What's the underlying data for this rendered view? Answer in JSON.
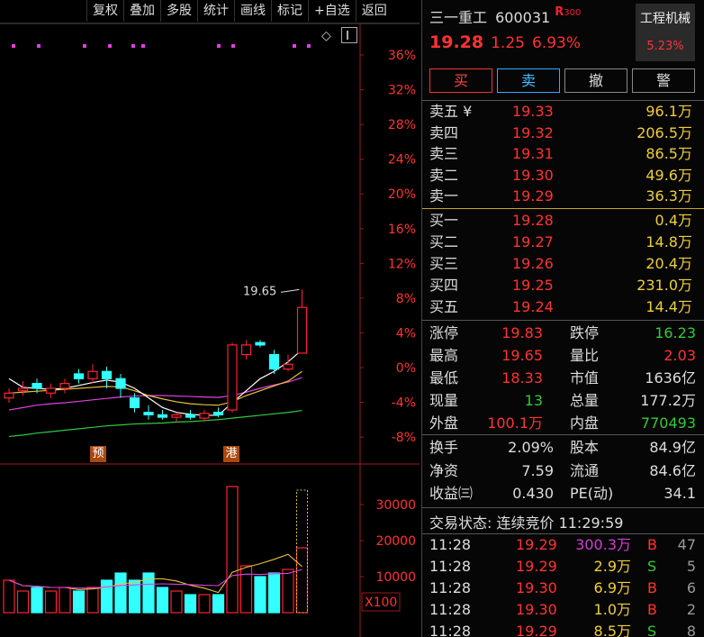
{
  "toolbar": {
    "buttons": [
      "复权",
      "叠加",
      "多股",
      "统计",
      "画线",
      "标记",
      "+自选",
      "返回"
    ]
  },
  "chart": {
    "peak_label": "19.65",
    "y_ticks": [
      "36%",
      "32%",
      "28%",
      "24%",
      "20%",
      "16%",
      "12%",
      "8%",
      "4%",
      "0%",
      "-4%",
      "-8%"
    ],
    "vol_ticks": [
      "30000",
      "20000",
      "10000"
    ],
    "vol_unit": "X100",
    "marker_yu": "预",
    "marker_gang": "港",
    "colors": {
      "up": "#f23",
      "down": "#3ff",
      "ma5": "#ffffff",
      "ma10": "#e8c23a",
      "ma20": "#e040e0",
      "ma60": "#2ecc40"
    }
  },
  "chart_data": {
    "type": "candlestick",
    "candles": [
      {
        "o": 17.4,
        "c": 17.5,
        "h": 17.6,
        "l": 17.3
      },
      {
        "o": 17.55,
        "c": 17.6,
        "h": 17.75,
        "l": 17.45
      },
      {
        "o": 17.7,
        "c": 17.6,
        "h": 17.8,
        "l": 17.5
      },
      {
        "o": 17.5,
        "c": 17.6,
        "h": 17.7,
        "l": 17.4
      },
      {
        "o": 17.6,
        "c": 17.7,
        "h": 17.8,
        "l": 17.5
      },
      {
        "o": 17.9,
        "c": 17.8,
        "h": 18.0,
        "l": 17.7
      },
      {
        "o": 17.8,
        "c": 17.95,
        "h": 18.1,
        "l": 17.7
      },
      {
        "o": 17.95,
        "c": 17.8,
        "h": 18.05,
        "l": 17.6
      },
      {
        "o": 17.8,
        "c": 17.6,
        "h": 17.9,
        "l": 17.4
      },
      {
        "o": 17.4,
        "c": 17.2,
        "h": 17.5,
        "l": 17.1
      },
      {
        "o": 17.1,
        "c": 17.05,
        "h": 17.25,
        "l": 16.95
      },
      {
        "o": 17.05,
        "c": 17.0,
        "h": 17.15,
        "l": 16.95
      },
      {
        "o": 17.0,
        "c": 17.05,
        "h": 17.1,
        "l": 16.9
      },
      {
        "o": 17.05,
        "c": 17.0,
        "h": 17.15,
        "l": 16.95
      },
      {
        "o": 16.98,
        "c": 17.08,
        "h": 17.15,
        "l": 16.9
      },
      {
        "o": 17.1,
        "c": 17.05,
        "h": 17.2,
        "l": 17.0
      },
      {
        "o": 17.15,
        "c": 18.5,
        "h": 18.55,
        "l": 17.1
      },
      {
        "o": 18.3,
        "c": 18.5,
        "h": 18.6,
        "l": 18.2
      },
      {
        "o": 18.55,
        "c": 18.5,
        "h": 18.6,
        "l": 18.45
      },
      {
        "o": 18.3,
        "c": 18.0,
        "h": 18.4,
        "l": 17.9
      },
      {
        "o": 18.0,
        "c": 18.1,
        "h": 18.3,
        "l": 17.95
      },
      {
        "o": 18.33,
        "c": 19.28,
        "h": 19.65,
        "l": 18.33
      }
    ],
    "volume": [
      9,
      6,
      7,
      6,
      7,
      6,
      7,
      9,
      11,
      9,
      11,
      7,
      6,
      5,
      5,
      5,
      35,
      13,
      10,
      11,
      12,
      18
    ],
    "ma5": [
      17.8,
      17.62,
      17.6,
      17.58,
      17.6,
      17.66,
      17.72,
      17.77,
      17.73,
      17.6,
      17.4,
      17.2,
      17.1,
      17.06,
      17.04,
      17.04,
      17.3,
      17.55,
      17.8,
      17.95,
      18.15,
      18.4
    ],
    "ma10": [
      17.5,
      17.52,
      17.54,
      17.56,
      17.58,
      17.6,
      17.62,
      17.64,
      17.63,
      17.55,
      17.45,
      17.38,
      17.32,
      17.28,
      17.26,
      17.25,
      17.32,
      17.45,
      17.55,
      17.65,
      17.75,
      17.95
    ],
    "ma20": [
      17.15,
      17.2,
      17.25,
      17.28,
      17.3,
      17.33,
      17.36,
      17.39,
      17.42,
      17.44,
      17.45,
      17.45,
      17.44,
      17.43,
      17.42,
      17.41,
      17.45,
      17.52,
      17.6,
      17.67,
      17.73,
      17.82
    ],
    "ma60": [
      16.6,
      16.63,
      16.67,
      16.7,
      16.73,
      16.76,
      16.79,
      16.82,
      16.84,
      16.86,
      16.87,
      16.88,
      16.9,
      16.91,
      16.93,
      16.95,
      16.98,
      17.01,
      17.04,
      17.07,
      17.1,
      17.14
    ]
  },
  "stock": {
    "name": "三一重工",
    "code": "600031",
    "rtag": "R",
    "rnum": "300",
    "price": "19.28",
    "change": "1.25",
    "pct": "6.93%",
    "sector_name": "工程机械",
    "sector_pct": "5.23%"
  },
  "actions": {
    "buy": "买",
    "sell": "卖",
    "cancel": "撤",
    "alert": "警"
  },
  "asks": [
    {
      "label": "卖五 ¥",
      "price": "19.33",
      "vol": "96.1万"
    },
    {
      "label": "卖四",
      "price": "19.32",
      "vol": "206.5万"
    },
    {
      "label": "卖三",
      "price": "19.31",
      "vol": "86.5万"
    },
    {
      "label": "卖二",
      "price": "19.30",
      "vol": "49.6万"
    },
    {
      "label": "卖一",
      "price": "19.29",
      "vol": "36.3万"
    }
  ],
  "bids": [
    {
      "label": "买一",
      "price": "19.28",
      "vol": "0.4万"
    },
    {
      "label": "买二",
      "price": "19.27",
      "vol": "14.8万"
    },
    {
      "label": "买三",
      "price": "19.26",
      "vol": "20.4万"
    },
    {
      "label": "买四",
      "price": "19.25",
      "vol": "231.0万"
    },
    {
      "label": "买五",
      "price": "19.24",
      "vol": "14.4万"
    }
  ],
  "stats": [
    {
      "k1": "涨停",
      "v1": "19.83",
      "c1": "#f33",
      "k2": "跌停",
      "v2": "16.23",
      "c2": "#3c3"
    },
    {
      "k1": "最高",
      "v1": "19.65",
      "c1": "#f33",
      "k2": "量比",
      "v2": "2.03",
      "c2": "#f33"
    },
    {
      "k1": "最低",
      "v1": "18.33",
      "c1": "#f33",
      "k2": "市值",
      "v2": "1636亿",
      "c2": "#ddd"
    },
    {
      "k1": "现量",
      "v1": "13",
      "c1": "#3c3",
      "k2": "总量",
      "v2": "177.2万",
      "c2": "#ddd"
    },
    {
      "k1": "外盘",
      "v1": "100.1万",
      "c1": "#f33",
      "k2": "内盘",
      "v2": "770493",
      "c2": "#3c3"
    }
  ],
  "fundamentals": [
    {
      "k1": "换手",
      "v1": "2.09%",
      "k2": "股本",
      "v2": "84.9亿"
    },
    {
      "k1": "净资",
      "v1": "7.59",
      "k2": "流通",
      "v2": "84.6亿"
    },
    {
      "k1": "收益㈢",
      "v1": "0.430",
      "k2": "PE(动)",
      "v2": "34.1"
    }
  ],
  "trade_status": "交易状态: 连续竞价 11:29:59",
  "ticks": [
    {
      "time": "11:28",
      "price": "19.29",
      "vol": "300.3万",
      "side": "B",
      "n": "47",
      "volColor": "#d040d0",
      "sideColor": "#f33"
    },
    {
      "time": "11:28",
      "price": "19.29",
      "vol": "2.9万",
      "side": "S",
      "n": "5",
      "volColor": "#eecf3a",
      "sideColor": "#3c3"
    },
    {
      "time": "11:28",
      "price": "19.30",
      "vol": "6.9万",
      "side": "B",
      "n": "6",
      "volColor": "#eecf3a",
      "sideColor": "#f33"
    },
    {
      "time": "11:28",
      "price": "19.30",
      "vol": "1.0万",
      "side": "B",
      "n": "2",
      "volColor": "#eecf3a",
      "sideColor": "#f33"
    },
    {
      "time": "11:28",
      "price": "19.29",
      "vol": "8.5万",
      "side": "S",
      "n": "8",
      "volColor": "#eecf3a",
      "sideColor": "#3c3"
    }
  ]
}
